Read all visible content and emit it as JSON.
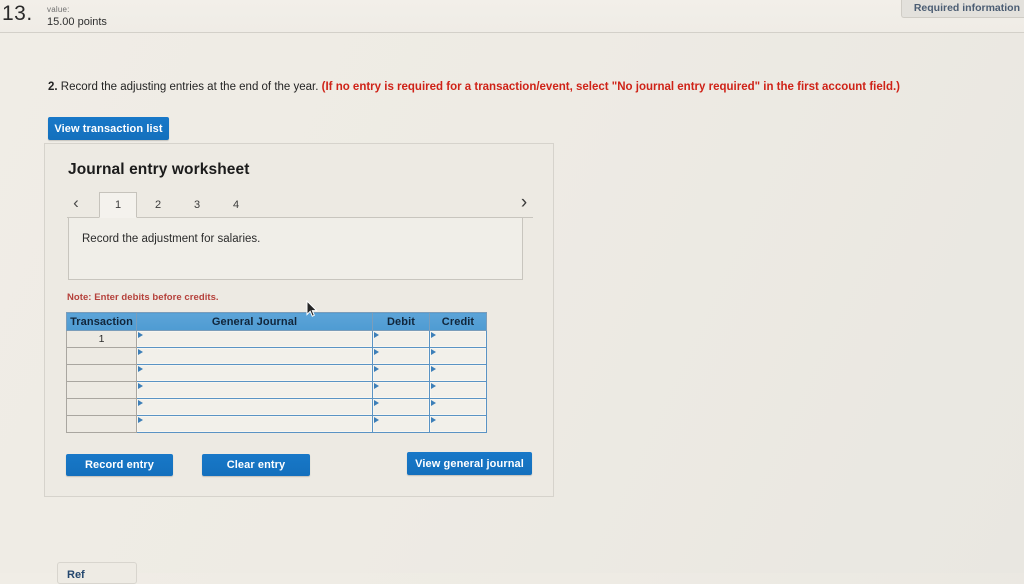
{
  "header": {
    "question_number": "13.",
    "value_label": "value:",
    "points": "15.00 points",
    "required_information_tab": "Required information"
  },
  "question": {
    "number": "2.",
    "text": "Record the adjusting entries at the end of the year.",
    "instruction_red": "(If no entry is required for a transaction/event, select \"No journal entry required\" in the first account field.)"
  },
  "toolbar": {
    "view_transaction_list_label": "View transaction list"
  },
  "worksheet": {
    "title": "Journal entry worksheet",
    "prev_icon": "‹",
    "next_icon": "›",
    "tabs": [
      {
        "label": "1",
        "active": true
      },
      {
        "label": "2",
        "active": false
      },
      {
        "label": "3",
        "active": false
      },
      {
        "label": "4",
        "active": false
      }
    ],
    "instruction": "Record the adjustment for salaries.",
    "note": "Note: Enter debits before credits."
  },
  "journal_table": {
    "columns": [
      "Transaction",
      "General Journal",
      "Debit",
      "Credit"
    ],
    "rows": [
      {
        "transaction": "1",
        "general_journal": "",
        "debit": "",
        "credit": ""
      },
      {
        "transaction": "",
        "general_journal": "",
        "debit": "",
        "credit": ""
      },
      {
        "transaction": "",
        "general_journal": "",
        "debit": "",
        "credit": ""
      },
      {
        "transaction": "",
        "general_journal": "",
        "debit": "",
        "credit": ""
      },
      {
        "transaction": "",
        "general_journal": "",
        "debit": "",
        "credit": ""
      },
      {
        "transaction": "",
        "general_journal": "",
        "debit": "",
        "credit": ""
      }
    ]
  },
  "footer": {
    "record_entry_label": "Record entry",
    "clear_entry_label": "Clear entry",
    "view_general_journal_label": "View general journal",
    "bottom_partial_label": "Ref"
  },
  "colors": {
    "accent_blue": "#1878c8",
    "table_header_blue": "#55a0d5",
    "note_red": "#b5413b",
    "instruction_red": "#cf2318",
    "page_background": "#eeebe4"
  }
}
